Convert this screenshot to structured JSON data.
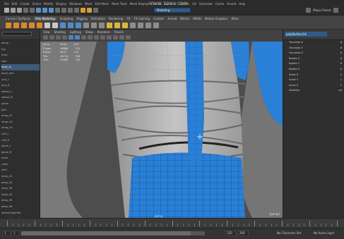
{
  "app": {
    "watermark": "WWW.3DXY.COM"
  },
  "menubar": {
    "items": [
      "File",
      "Edit",
      "Create",
      "Select",
      "Modify",
      "Display",
      "Windows",
      "Mesh",
      "Edit Mesh",
      "Mesh Tools",
      "Mesh Display",
      "Curves",
      "Surfaces",
      "Deform",
      "UV",
      "Generate",
      "Cache",
      "Arnold",
      "Help"
    ],
    "workspace_label": "Modeling",
    "right_label": "Maya Classic"
  },
  "shelf": {
    "tabs": [
      "Curves / Surfaces",
      "Poly Modeling",
      "Sculpting",
      "Rigging",
      "Animation",
      "Rendering",
      "FX",
      "FX Caching",
      "Custom",
      "Arnold",
      "Bifrost",
      "MASH",
      "Motion Graphics",
      "XGen"
    ],
    "active_tab": "Poly Modeling"
  },
  "panel": {
    "menus": [
      "View",
      "Shading",
      "Lighting",
      "Show",
      "Renderer",
      "Panels"
    ],
    "hud": [
      {
        "label": "Verts:",
        "a": "9444",
        "b": "120"
      },
      {
        "label": "Edges:",
        "a": "18866",
        "b": "232"
      },
      {
        "label": "Faces:",
        "a": "9427",
        "b": "114"
      },
      {
        "label": "Tris:",
        "a": "18714",
        "b": "228"
      },
      {
        "label": "UVs:",
        "a": "10089",
        "b": "130"
      }
    ],
    "camera_label": "persp",
    "view_label": "[persp]"
  },
  "outliner": {
    "items": [
      "persp",
      "top",
      "front",
      "side",
      "body_lo",
      "body_mid",
      "arm_L",
      "arm_R",
      "sleeve_L",
      "sleeve_R",
      "pants",
      "belt",
      "strap_01",
      "strap_02",
      "strap_03",
      "cuff_L",
      "cuff_R",
      "glove_L",
      "glove_R",
      "hood",
      "collar",
      "shirt",
      "wrap_01",
      "wrap_02",
      "wrap_03",
      "wrap_04",
      "wrap_05",
      "wrap_06",
      "defaultLightSet",
      "defaultObjectSet"
    ],
    "selected_index": 4
  },
  "channelbox": {
    "object": "polySurface14",
    "rows": [
      {
        "name": "Translate X",
        "value": "0"
      },
      {
        "name": "Translate Y",
        "value": "0"
      },
      {
        "name": "Translate Z",
        "value": "0"
      },
      {
        "name": "Rotate X",
        "value": "0"
      },
      {
        "name": "Rotate Y",
        "value": "0"
      },
      {
        "name": "Rotate Z",
        "value": "0"
      },
      {
        "name": "Scale X",
        "value": "1"
      },
      {
        "name": "Scale Y",
        "value": "1"
      },
      {
        "name": "Scale Z",
        "value": "1"
      },
      {
        "name": "Visibility",
        "value": "on"
      }
    ]
  },
  "range": {
    "start": "1",
    "start_anim": "1",
    "end": "120",
    "end_anim": "200",
    "right_a": "No Character Set",
    "right_b": "No Anim Layer"
  },
  "colors": {
    "accent": "#2d5c88",
    "mesh_blue": "#2a7fd6",
    "cloth": "#b9b9b9"
  }
}
